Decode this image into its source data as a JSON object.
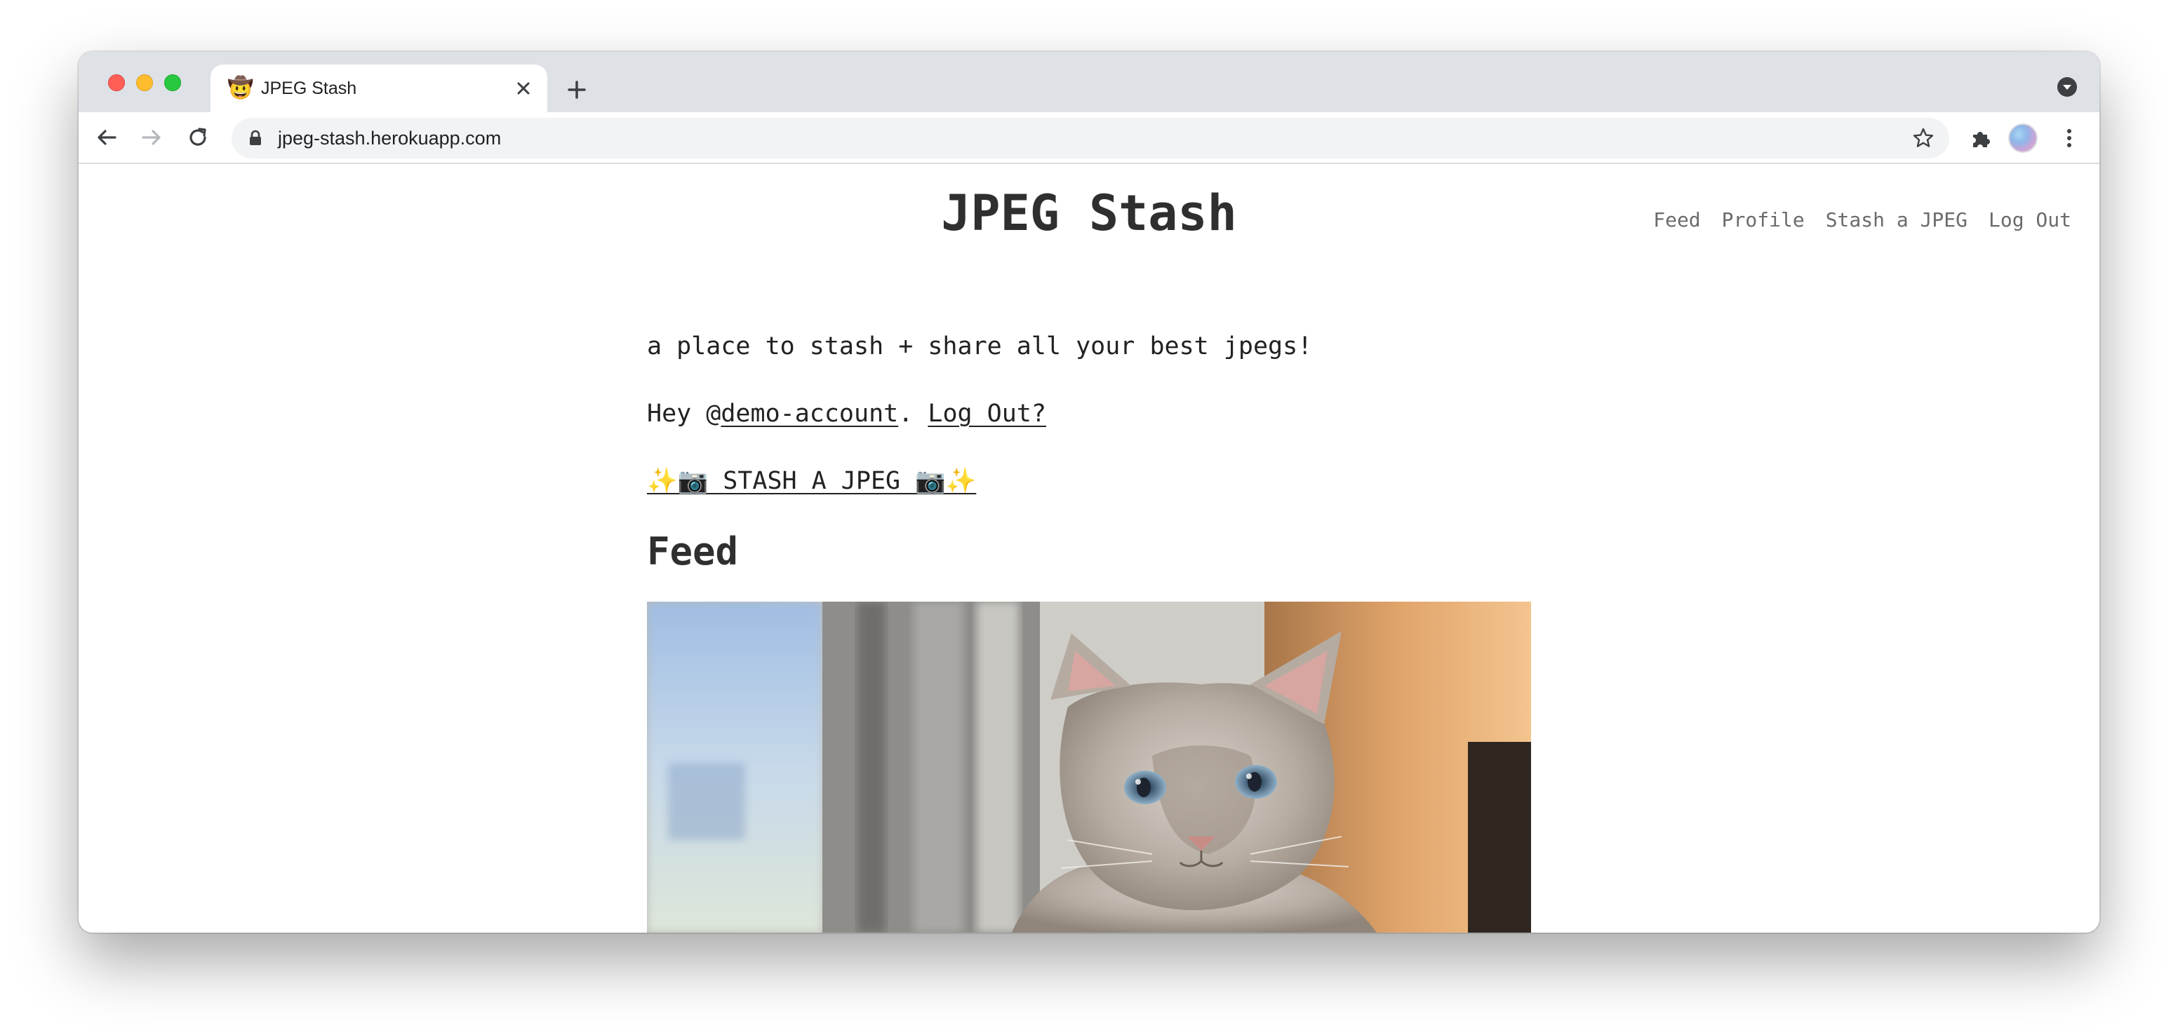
{
  "browser": {
    "tab": {
      "favicon": "🤠",
      "title": "JPEG Stash"
    },
    "address_bar": {
      "url": "jpeg-stash.herokuapp.com"
    }
  },
  "site": {
    "title": "JPEG Stash",
    "nav": [
      "Feed",
      "Profile",
      "Stash a JPEG",
      "Log Out"
    ],
    "tagline": "a place to stash + share all your best jpegs!",
    "greeting": {
      "prefix": "Hey @",
      "username": "demo-account",
      "separator": ". ",
      "logout_link": "Log Out?"
    },
    "stash_link": "✨📷 STASH A JPEG 📷✨",
    "feed_heading": "Feed"
  },
  "colors": {
    "tab_strip": "#dee1e6",
    "omnibox": "#f1f3f4",
    "text": "#222222",
    "nav_text": "#6b6b6b"
  },
  "icons": [
    "back-icon",
    "forward-icon",
    "reload-icon",
    "lock-icon",
    "star-icon",
    "extensions-icon",
    "menu-icon",
    "close-icon",
    "plus-icon",
    "tab-search-icon"
  ]
}
